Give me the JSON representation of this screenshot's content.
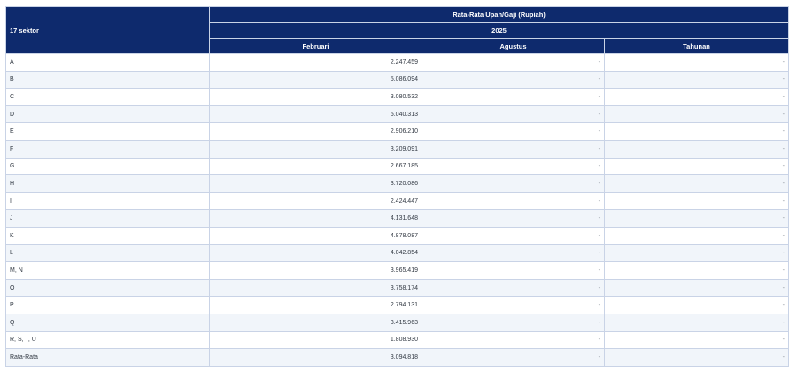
{
  "header": {
    "row_label": "17 sektor",
    "group_title": "Rata-Rata Upah/Gaji (Rupiah)",
    "year": "2025",
    "columns": [
      "Februari",
      "Agustus",
      "Tahunan"
    ]
  },
  "rows": [
    {
      "sektor": "A",
      "februari": "2.247.459",
      "agustus": "-",
      "tahunan": "-"
    },
    {
      "sektor": "B",
      "februari": "5.086.094",
      "agustus": "-",
      "tahunan": "-"
    },
    {
      "sektor": "C",
      "februari": "3.080.532",
      "agustus": "-",
      "tahunan": "-"
    },
    {
      "sektor": "D",
      "februari": "5.040.313",
      "agustus": "-",
      "tahunan": "-"
    },
    {
      "sektor": "E",
      "februari": "2.906.210",
      "agustus": "-",
      "tahunan": "-"
    },
    {
      "sektor": "F",
      "februari": "3.209.091",
      "agustus": "-",
      "tahunan": "-"
    },
    {
      "sektor": "G",
      "februari": "2.667.185",
      "agustus": "-",
      "tahunan": "-"
    },
    {
      "sektor": "H",
      "februari": "3.720.086",
      "agustus": "-",
      "tahunan": "-"
    },
    {
      "sektor": "I",
      "februari": "2.424.447",
      "agustus": "-",
      "tahunan": "-"
    },
    {
      "sektor": "J",
      "februari": "4.131.648",
      "agustus": "-",
      "tahunan": "-"
    },
    {
      "sektor": "K",
      "februari": "4.878.087",
      "agustus": "-",
      "tahunan": "-"
    },
    {
      "sektor": "L",
      "februari": "4.042.854",
      "agustus": "-",
      "tahunan": "-"
    },
    {
      "sektor": "M, N",
      "februari": "3.965.419",
      "agustus": "-",
      "tahunan": "-"
    },
    {
      "sektor": "O",
      "februari": "3.758.174",
      "agustus": "-",
      "tahunan": "-"
    },
    {
      "sektor": "P",
      "februari": "2.794.131",
      "agustus": "-",
      "tahunan": "-"
    },
    {
      "sektor": "Q",
      "februari": "3.415.963",
      "agustus": "-",
      "tahunan": "-"
    },
    {
      "sektor": "R, S, T, U",
      "februari": "1.808.930",
      "agustus": "-",
      "tahunan": "-"
    },
    {
      "sektor": "Rata-Rata",
      "februari": "3.094.818",
      "agustus": "-",
      "tahunan": "-"
    }
  ],
  "colors": {
    "header_bg": "#0e2a6d",
    "header_text": "#ffffff",
    "stripe": "#f1f5fa",
    "border": "#c9d3e6"
  }
}
